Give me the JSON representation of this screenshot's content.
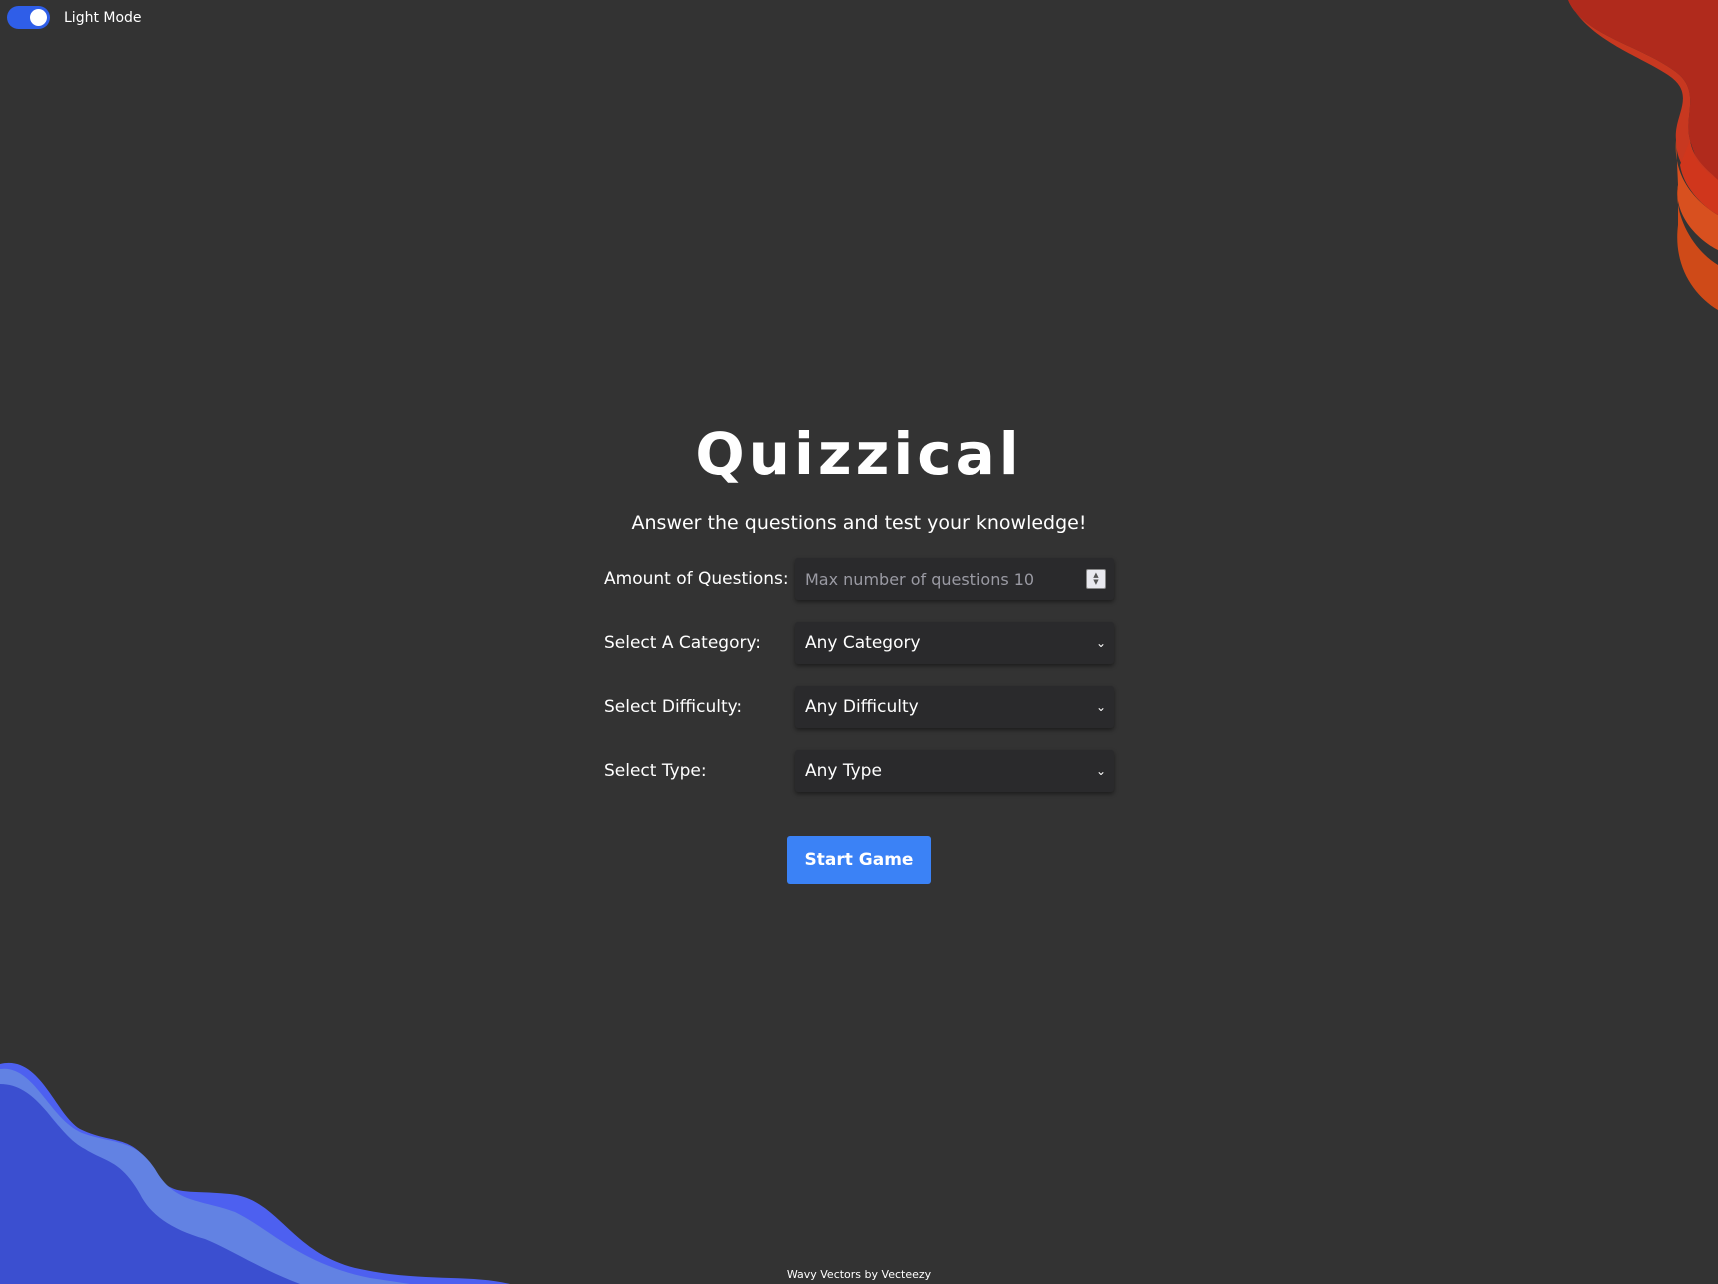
{
  "toggle": {
    "label": "Light Mode",
    "on": true,
    "color": "#2f5ee8"
  },
  "header": {
    "title": "Quizzical",
    "subtitle": "Answer the questions and test your knowledge!"
  },
  "form": {
    "amount": {
      "label": "Amount of Questions:",
      "placeholder": "Max number of questions 10",
      "value": ""
    },
    "category": {
      "label": "Select A Category:",
      "selected": "Any Category"
    },
    "difficulty": {
      "label": "Select Difficulty:",
      "selected": "Any Difficulty"
    },
    "type": {
      "label": "Select Type:",
      "selected": "Any Type"
    }
  },
  "start_button": {
    "label": "Start Game",
    "color": "#3b82f6"
  },
  "footer": {
    "credit": "Wavy Vectors by Vecteezy"
  },
  "colors": {
    "background": "#333333",
    "field_background": "#2a2a2c",
    "wave_top_right": [
      "#b02a1c",
      "#d0361c",
      "#d9552a"
    ],
    "wave_bottom_left": [
      "#4d60f0",
      "#3b4fd0",
      "#6282e3"
    ]
  },
  "icons": {
    "select": "chevron-down-icon",
    "number": "spinner-icon"
  }
}
